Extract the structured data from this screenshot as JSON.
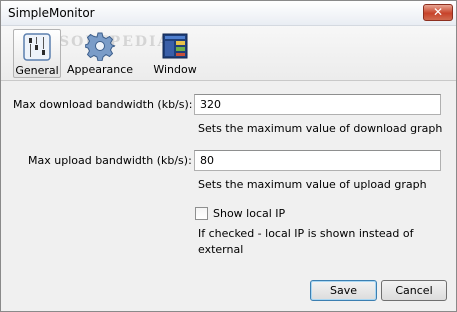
{
  "window": {
    "title": "SimpleMonitor",
    "close_glyph": "✕"
  },
  "toolbar": {
    "watermark": "SOFTPEDIA",
    "items": [
      {
        "label": "General",
        "icon": "general-settings-icon",
        "active": true
      },
      {
        "label": "Appearance",
        "icon": "gear-icon",
        "active": false
      },
      {
        "label": "Window",
        "icon": "window-icon",
        "active": false
      }
    ]
  },
  "general": {
    "download": {
      "label": "Max download bandwidth (kb/s):",
      "value": "320",
      "hint": "Sets the maximum value of download graph"
    },
    "upload": {
      "label": "Max upload bandwidth (kb/s):",
      "value": "80",
      "hint": "Sets the maximum value of upload graph"
    },
    "show_local_ip": {
      "label": "Show local IP",
      "checked": false,
      "hint_line1": "If checked - local IP is shown instead of",
      "hint_line2": "external"
    }
  },
  "buttons": {
    "save": "Save",
    "cancel": "Cancel"
  },
  "colors": {
    "accent": "#3c7fb1",
    "close": "#c7432a"
  }
}
